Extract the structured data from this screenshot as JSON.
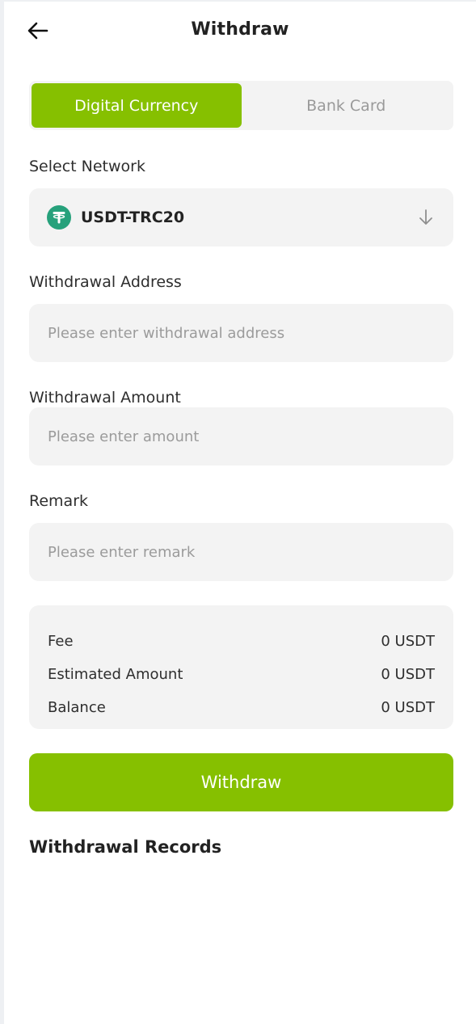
{
  "header": {
    "title": "Withdraw",
    "back_icon": "arrow-left-icon"
  },
  "tabs": [
    {
      "label": "Digital Currency",
      "active": true
    },
    {
      "label": "Bank Card",
      "active": false
    }
  ],
  "network": {
    "label": "Select Network",
    "value": "USDT-TRC20",
    "coin_icon": "tether-icon",
    "chevron_icon": "arrow-down-icon"
  },
  "address": {
    "label": "Withdrawal Address",
    "value": "",
    "placeholder": "Please enter withdrawal address"
  },
  "amount": {
    "label": "Withdrawal Amount",
    "value": "",
    "placeholder": "Please enter amount"
  },
  "remark": {
    "label": "Remark",
    "value": "",
    "placeholder": "Please enter remark"
  },
  "summary": {
    "rows": [
      {
        "label": "Fee",
        "value": "0 USDT"
      },
      {
        "label": "Estimated Amount",
        "value": "0 USDT"
      },
      {
        "label": "Balance",
        "value": "0 USDT"
      }
    ]
  },
  "submit_label": "Withdraw",
  "records_title": "Withdrawal Records",
  "colors": {
    "accent": "#86c000",
    "tether": "#26a17b",
    "field_bg": "#f3f3f3"
  }
}
